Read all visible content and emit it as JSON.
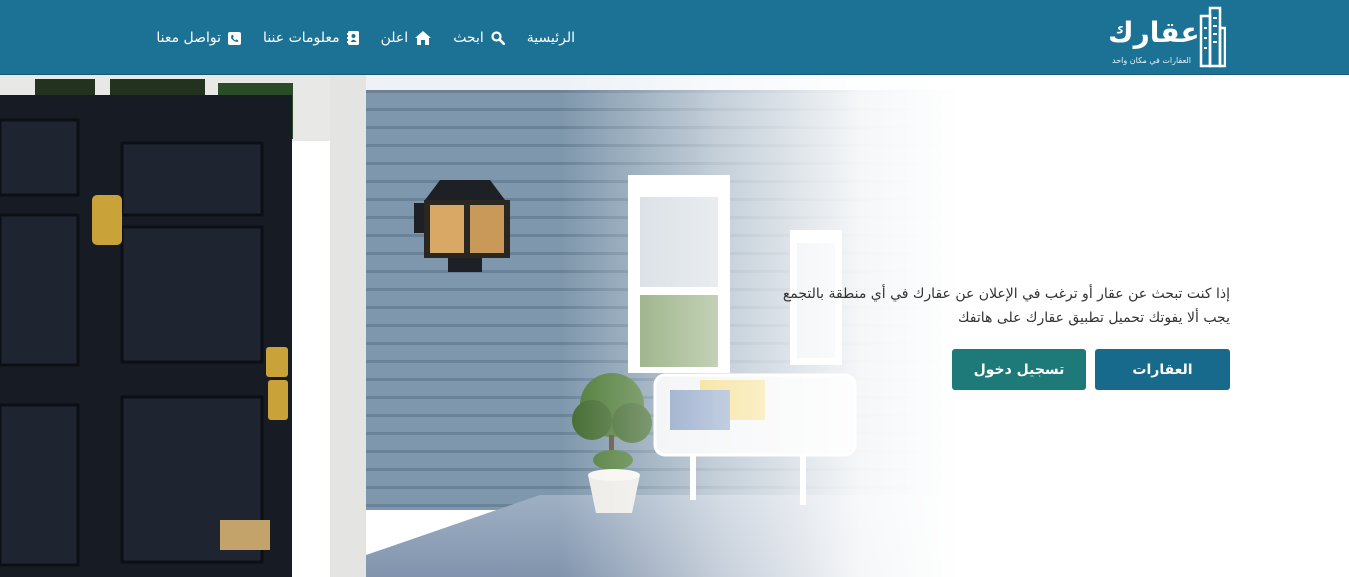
{
  "header": {
    "logo_title": "عقارك",
    "logo_subtitle": "العقارات في مكان واحد",
    "nav": [
      {
        "label": "الرئيسية",
        "icon": "none"
      },
      {
        "label": "ابحث",
        "icon": "search-icon"
      },
      {
        "label": "اعلن",
        "icon": "home-icon"
      },
      {
        "label": "معلومات عننا",
        "icon": "address-book-icon"
      },
      {
        "label": "تواصل معنا",
        "icon": "phone-square-icon"
      }
    ]
  },
  "hero": {
    "text": "إذا كنت تبحث عن عقار أو ترغب في الإعلان عن عقارك في أي منطقة بالتجمع يجب ألا يفوتك تحميل تطبيق عقارك على هاتفك",
    "primary_button": "العقارات",
    "secondary_button": "تسجيل دخول"
  },
  "colors": {
    "header_bg": "#1c7295",
    "primary_button": "#176a8c",
    "secondary_button": "#1d7a78",
    "text": "#333333"
  }
}
